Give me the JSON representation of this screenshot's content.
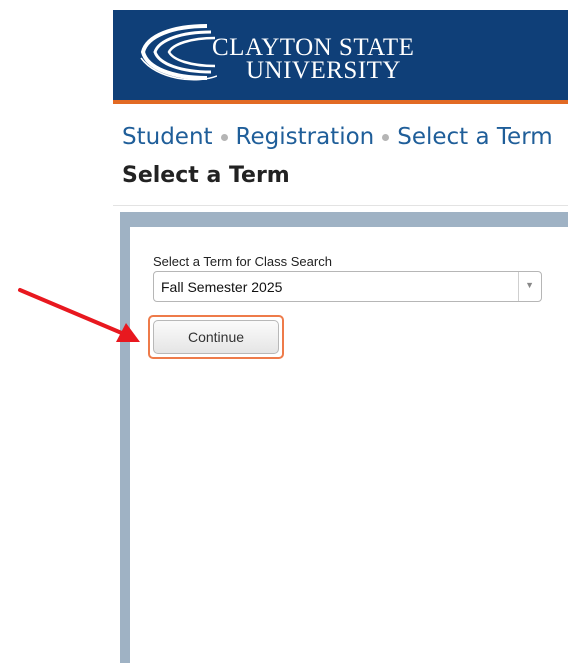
{
  "header": {
    "logo_line1": "CLAYTON STATE",
    "logo_line2": "UNIVERSITY",
    "background_color": "#0f3f78",
    "accent_color": "#e26a24"
  },
  "breadcrumb": [
    "Student",
    "Registration",
    "Select a Term"
  ],
  "page_title": "Select a Term",
  "term_form": {
    "label": "Select a Term for Class Search",
    "selected_term": "Fall Semester 2025",
    "continue_label": "Continue"
  },
  "annotation": {
    "arrow_color": "#e8181f",
    "highlight_color": "#ee7b4a"
  }
}
